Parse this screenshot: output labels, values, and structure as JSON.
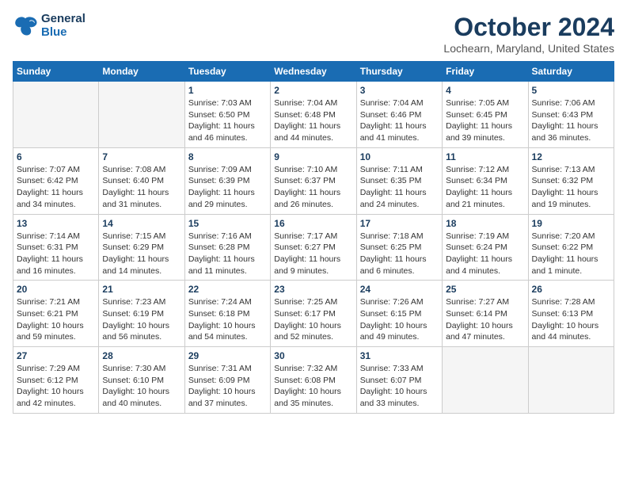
{
  "header": {
    "logo_line1": "General",
    "logo_line2": "Blue",
    "month": "October 2024",
    "location": "Lochearn, Maryland, United States"
  },
  "weekdays": [
    "Sunday",
    "Monday",
    "Tuesday",
    "Wednesday",
    "Thursday",
    "Friday",
    "Saturday"
  ],
  "weeks": [
    [
      {
        "day": "",
        "info": ""
      },
      {
        "day": "",
        "info": ""
      },
      {
        "day": "1",
        "info": "Sunrise: 7:03 AM\nSunset: 6:50 PM\nDaylight: 11 hours and 46 minutes."
      },
      {
        "day": "2",
        "info": "Sunrise: 7:04 AM\nSunset: 6:48 PM\nDaylight: 11 hours and 44 minutes."
      },
      {
        "day": "3",
        "info": "Sunrise: 7:04 AM\nSunset: 6:46 PM\nDaylight: 11 hours and 41 minutes."
      },
      {
        "day": "4",
        "info": "Sunrise: 7:05 AM\nSunset: 6:45 PM\nDaylight: 11 hours and 39 minutes."
      },
      {
        "day": "5",
        "info": "Sunrise: 7:06 AM\nSunset: 6:43 PM\nDaylight: 11 hours and 36 minutes."
      }
    ],
    [
      {
        "day": "6",
        "info": "Sunrise: 7:07 AM\nSunset: 6:42 PM\nDaylight: 11 hours and 34 minutes."
      },
      {
        "day": "7",
        "info": "Sunrise: 7:08 AM\nSunset: 6:40 PM\nDaylight: 11 hours and 31 minutes."
      },
      {
        "day": "8",
        "info": "Sunrise: 7:09 AM\nSunset: 6:39 PM\nDaylight: 11 hours and 29 minutes."
      },
      {
        "day": "9",
        "info": "Sunrise: 7:10 AM\nSunset: 6:37 PM\nDaylight: 11 hours and 26 minutes."
      },
      {
        "day": "10",
        "info": "Sunrise: 7:11 AM\nSunset: 6:35 PM\nDaylight: 11 hours and 24 minutes."
      },
      {
        "day": "11",
        "info": "Sunrise: 7:12 AM\nSunset: 6:34 PM\nDaylight: 11 hours and 21 minutes."
      },
      {
        "day": "12",
        "info": "Sunrise: 7:13 AM\nSunset: 6:32 PM\nDaylight: 11 hours and 19 minutes."
      }
    ],
    [
      {
        "day": "13",
        "info": "Sunrise: 7:14 AM\nSunset: 6:31 PM\nDaylight: 11 hours and 16 minutes."
      },
      {
        "day": "14",
        "info": "Sunrise: 7:15 AM\nSunset: 6:29 PM\nDaylight: 11 hours and 14 minutes."
      },
      {
        "day": "15",
        "info": "Sunrise: 7:16 AM\nSunset: 6:28 PM\nDaylight: 11 hours and 11 minutes."
      },
      {
        "day": "16",
        "info": "Sunrise: 7:17 AM\nSunset: 6:27 PM\nDaylight: 11 hours and 9 minutes."
      },
      {
        "day": "17",
        "info": "Sunrise: 7:18 AM\nSunset: 6:25 PM\nDaylight: 11 hours and 6 minutes."
      },
      {
        "day": "18",
        "info": "Sunrise: 7:19 AM\nSunset: 6:24 PM\nDaylight: 11 hours and 4 minutes."
      },
      {
        "day": "19",
        "info": "Sunrise: 7:20 AM\nSunset: 6:22 PM\nDaylight: 11 hours and 1 minute."
      }
    ],
    [
      {
        "day": "20",
        "info": "Sunrise: 7:21 AM\nSunset: 6:21 PM\nDaylight: 10 hours and 59 minutes."
      },
      {
        "day": "21",
        "info": "Sunrise: 7:23 AM\nSunset: 6:19 PM\nDaylight: 10 hours and 56 minutes."
      },
      {
        "day": "22",
        "info": "Sunrise: 7:24 AM\nSunset: 6:18 PM\nDaylight: 10 hours and 54 minutes."
      },
      {
        "day": "23",
        "info": "Sunrise: 7:25 AM\nSunset: 6:17 PM\nDaylight: 10 hours and 52 minutes."
      },
      {
        "day": "24",
        "info": "Sunrise: 7:26 AM\nSunset: 6:15 PM\nDaylight: 10 hours and 49 minutes."
      },
      {
        "day": "25",
        "info": "Sunrise: 7:27 AM\nSunset: 6:14 PM\nDaylight: 10 hours and 47 minutes."
      },
      {
        "day": "26",
        "info": "Sunrise: 7:28 AM\nSunset: 6:13 PM\nDaylight: 10 hours and 44 minutes."
      }
    ],
    [
      {
        "day": "27",
        "info": "Sunrise: 7:29 AM\nSunset: 6:12 PM\nDaylight: 10 hours and 42 minutes."
      },
      {
        "day": "28",
        "info": "Sunrise: 7:30 AM\nSunset: 6:10 PM\nDaylight: 10 hours and 40 minutes."
      },
      {
        "day": "29",
        "info": "Sunrise: 7:31 AM\nSunset: 6:09 PM\nDaylight: 10 hours and 37 minutes."
      },
      {
        "day": "30",
        "info": "Sunrise: 7:32 AM\nSunset: 6:08 PM\nDaylight: 10 hours and 35 minutes."
      },
      {
        "day": "31",
        "info": "Sunrise: 7:33 AM\nSunset: 6:07 PM\nDaylight: 10 hours and 33 minutes."
      },
      {
        "day": "",
        "info": ""
      },
      {
        "day": "",
        "info": ""
      }
    ]
  ]
}
